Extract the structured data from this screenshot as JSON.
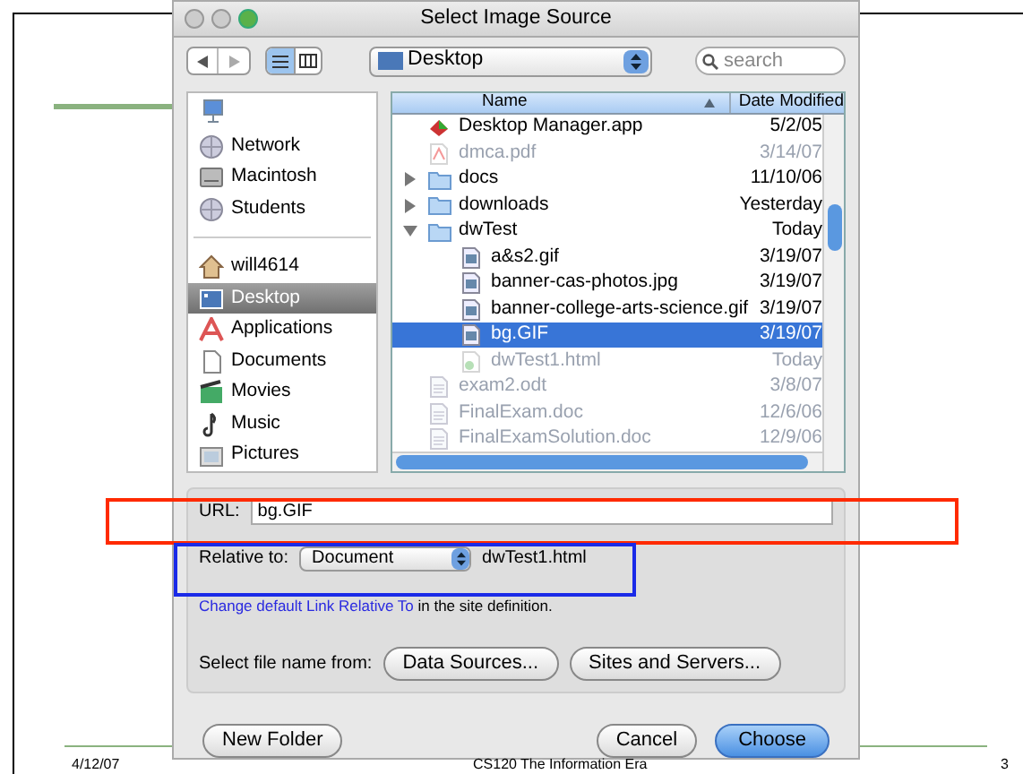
{
  "window": {
    "title": "Select Image Source"
  },
  "toolbar": {
    "location": "Desktop",
    "search": {
      "placeholder": "search"
    }
  },
  "sidebar": {
    "devices": [
      {
        "label": "Network",
        "selected": false
      },
      {
        "label": "Macintosh",
        "selected": false
      },
      {
        "label": "Students",
        "selected": false
      }
    ],
    "places": [
      {
        "label": "will4614",
        "selected": false
      },
      {
        "label": "Desktop",
        "selected": true
      },
      {
        "label": "Applications",
        "selected": false
      },
      {
        "label": "Documents",
        "selected": false
      },
      {
        "label": "Movies",
        "selected": false
      },
      {
        "label": "Music",
        "selected": false
      },
      {
        "label": "Pictures",
        "selected": false
      }
    ]
  },
  "file_list": {
    "columns": [
      "Name",
      "Date Modified"
    ],
    "rows": [
      {
        "kind": "app",
        "name": "Desktop Manager.app",
        "date": "5/2/05",
        "disabled": false,
        "selected": false
      },
      {
        "kind": "pdf",
        "name": "dmca.pdf",
        "date": "3/14/07",
        "disabled": true,
        "selected": false
      },
      {
        "kind": "folder",
        "name": "docs",
        "date": "11/10/06",
        "disabled": false,
        "selected": false,
        "expanded": false
      },
      {
        "kind": "folder",
        "name": "downloads",
        "date": "Yesterday",
        "disabled": false,
        "selected": false,
        "expanded": false
      },
      {
        "kind": "folder",
        "name": "dwTest",
        "date": "Today",
        "disabled": false,
        "selected": false,
        "expanded": true,
        "children": [
          {
            "kind": "image",
            "name": "a&s2.gif",
            "date": "3/19/07",
            "disabled": false,
            "selected": false
          },
          {
            "kind": "image",
            "name": "banner-cas-photos.jpg",
            "date": "3/19/07",
            "disabled": false,
            "selected": false
          },
          {
            "kind": "image",
            "name": "banner-college-arts-science.gif",
            "date": "3/19/07",
            "disabled": false,
            "selected": false
          },
          {
            "kind": "image",
            "name": "bg.GIF",
            "date": "3/19/07",
            "disabled": false,
            "selected": true
          },
          {
            "kind": "html",
            "name": "dwTest1.html",
            "date": "Today",
            "disabled": true,
            "selected": false
          }
        ]
      },
      {
        "kind": "doc",
        "name": "exam2.odt",
        "date": "3/8/07",
        "disabled": true,
        "selected": false
      },
      {
        "kind": "doc",
        "name": "FinalExam.doc",
        "date": "12/6/06",
        "disabled": true,
        "selected": false
      },
      {
        "kind": "doc",
        "name": "FinalExamSolution.doc",
        "date": "12/9/06",
        "disabled": true,
        "selected": false
      }
    ]
  },
  "url": {
    "label": "URL:",
    "value": "bg.GIF"
  },
  "relative_to": {
    "label": "Relative to:",
    "option": "Document",
    "file": "dwTest1.html"
  },
  "note": {
    "link": "Change default Link Relative To",
    "text": " in the site definition."
  },
  "select_from": {
    "label": "Select file name from:",
    "buttons": [
      "Data Sources...",
      "Sites and Servers..."
    ]
  },
  "buttons": {
    "new_folder": "New Folder",
    "cancel": "Cancel",
    "choose": "Choose"
  },
  "footer": {
    "date": "4/12/07",
    "title": "CS120 The Information Era",
    "page": "3"
  }
}
